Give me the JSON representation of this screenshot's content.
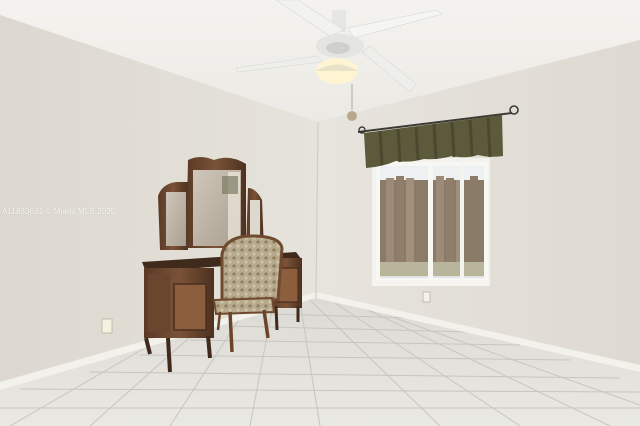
{
  "photo": {
    "watermark": "A11833631 © Miami MLS 2025",
    "subjects": [
      "ceiling-fan",
      "vanity-with-mirror",
      "upholstered-chair",
      "window",
      "valance-curtain",
      "tile-floor",
      "baseboard",
      "wall-outlet"
    ]
  }
}
